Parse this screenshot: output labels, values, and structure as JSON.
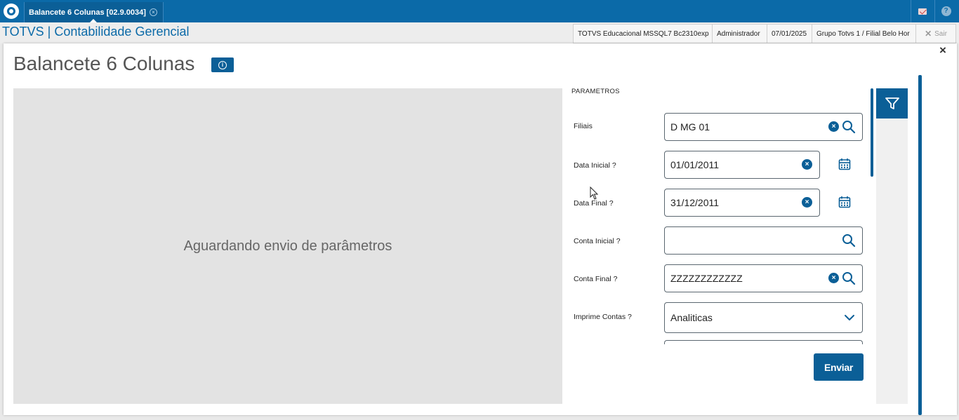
{
  "topbar": {
    "tab_label": "Balancete 6 Colunas [02.9.0034]",
    "tab_close": "×"
  },
  "header": {
    "app_title": "TOTVS | Contabilidade Gerencial",
    "environment": "TOTVS Educacional MSSQL7 Bc2310exp",
    "user": "Administrador",
    "date": "07/01/2025",
    "branch": "Grupo Totvs 1 / Filial Belo Hor",
    "exit_label": "Sair",
    "exit_icon": "✕"
  },
  "modal": {
    "title": "Balancete 6 Colunas",
    "close": "×",
    "info_glyph": "i",
    "preview_message": "Aguardando envio de parâmetros"
  },
  "params": {
    "section_title": "PARAMETROS",
    "fields": [
      {
        "label": "Filiais",
        "value": "D MG 01",
        "clear": "×"
      },
      {
        "label": "Data Inicial ?",
        "value": "01/01/2011",
        "clear": "×"
      },
      {
        "label": "Data Final ?",
        "value": "31/12/2011",
        "clear": "×"
      },
      {
        "label": "Conta Inicial ?",
        "value": ""
      },
      {
        "label": "Conta Final ?",
        "value": "ZZZZZZZZZZZZ",
        "clear": "×"
      },
      {
        "label": "Imprime Contas ?",
        "value": "Analiticas"
      }
    ],
    "submit_label": "Enviar"
  },
  "colors": {
    "primary": "#0b6aa8",
    "button": "#0b5f97",
    "preview_bg": "#e3e3e3"
  }
}
